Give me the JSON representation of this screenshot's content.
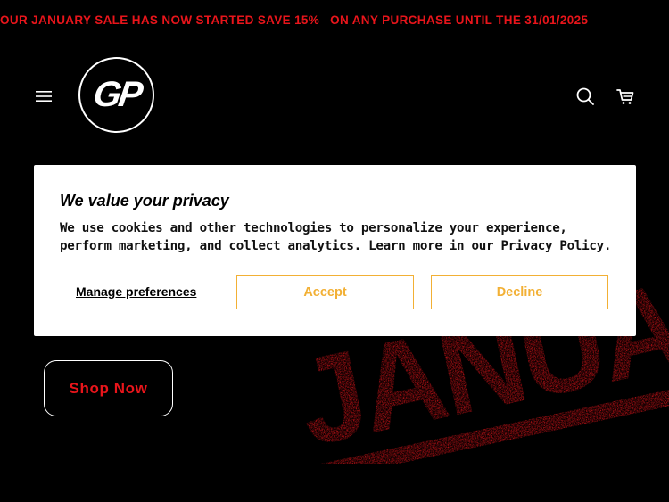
{
  "announcement": {
    "part1": "OUR JANUARY SALE HAS NOW STARTED SAVE 15%",
    "part2": "ON ANY PURCHASE UNTIL THE 31/01/2025"
  },
  "header": {
    "logo_text": "GP"
  },
  "hero": {
    "banner_text": "JANUARY S",
    "shop_now_label": "Shop Now"
  },
  "cookie_dialog": {
    "title": "We value your privacy",
    "body_line1": "We use cookies and other technologies to personalize your experience,",
    "body_line2": "perform marketing, and collect analytics. Learn more in our ",
    "privacy_link": "Privacy Policy.",
    "manage_label": "Manage preferences",
    "accept_label": "Accept",
    "decline_label": "Decline"
  },
  "colors": {
    "accent_red": "#e8151b",
    "button_gold": "#f2b035",
    "background": "#000000"
  }
}
